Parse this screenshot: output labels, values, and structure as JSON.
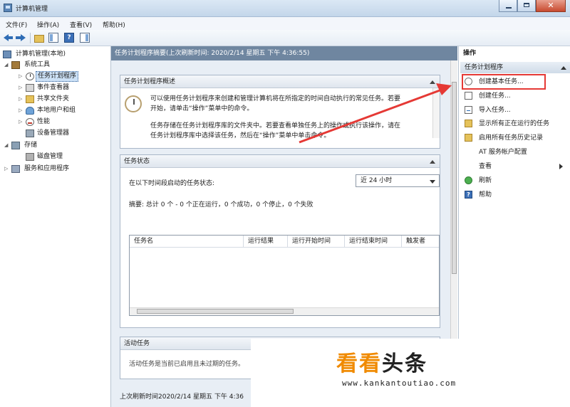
{
  "window": {
    "title": "计算机管理",
    "close_glyph": "✕"
  },
  "menu": [
    "文件(F)",
    "操作(A)",
    "查看(V)",
    "帮助(H)"
  ],
  "toolbar": {
    "help_glyph": "?"
  },
  "tree": {
    "root": "计算机管理(本地)",
    "system_tools": "系统工具",
    "task_scheduler": "任务计划程序",
    "event_viewer": "事件查看器",
    "shared_folders": "共享文件夹",
    "local_users": "本地用户和组",
    "performance": "性能",
    "device_manager": "设备管理器",
    "storage": "存储",
    "disk_management": "磁盘管理",
    "services_apps": "服务和应用程序"
  },
  "center": {
    "header": "任务计划程序摘要(上次刷新时间: 2020/2/14 星期五 下午 4:36:55)",
    "overview": {
      "title": "任务计划程序概述",
      "line1": "可以使用任务计划程序来创建和管理计算机将在所指定的时间自动执行的常见任务。若要",
      "line2": "开始，请单击“操作”菜单中的命令。",
      "line3": "任务存储在任务计划程序库的文件夹中。若要查看单独任务上的操作或执行该操作，请在",
      "line4": "任务计划程序库中选择该任务，然后在“操作”菜单中单击命令。"
    },
    "status": {
      "title": "任务状态",
      "prompt": "在以下时间段启动的任务状态:",
      "range": "近 24 小时",
      "summary": "摘要: 总计 0 个 - 0 个正在运行，0 个成功，0 个停止，0 个失败",
      "columns": [
        "任务名",
        "运行结果",
        "运行开始时间",
        "运行结束时间",
        "触发者"
      ]
    },
    "active": {
      "title": "活动任务",
      "partial_text": "活动任务是当前已启用且未过期的任务。"
    },
    "footer": "上次刷新时间2020/2/14 星期五 下午 4:36"
  },
  "actions": {
    "header": "操作",
    "sub": "任务计划程序",
    "items": [
      "创建基本任务...",
      "创建任务...",
      "导入任务...",
      "显示所有正在运行的任务",
      "启用所有任务历史记录",
      "AT 服务帐户配置",
      "查看",
      "刷新",
      "帮助"
    ]
  },
  "watermark": {
    "logo_a": "看看",
    "logo_b": "头条",
    "url": "www.kankantoutiao.com"
  },
  "colors": {
    "accent_red": "#e53935",
    "header_blue": "#6f86a0",
    "watermark_orange": "#f08a00"
  }
}
